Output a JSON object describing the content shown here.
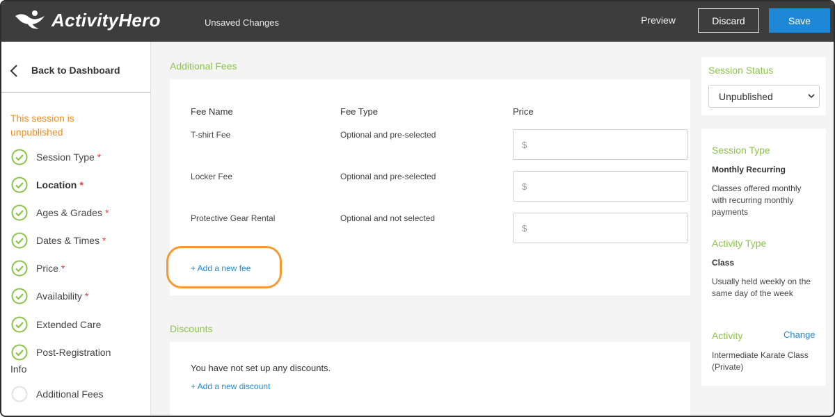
{
  "header": {
    "logo_text": "ActivityHero",
    "status_text": "Unsaved Changes",
    "preview_label": "Preview",
    "discard_label": "Discard",
    "save_label": "Save",
    "bg_color": "#3d3d3d",
    "save_color": "#1e88d6"
  },
  "sidebar": {
    "back_label": "Back to Dashboard",
    "unpublished_note": "This session is unpublished",
    "steps": [
      {
        "label": "Session Type",
        "required": true,
        "done": true,
        "active": false
      },
      {
        "label": "Location",
        "required": true,
        "done": true,
        "active": true
      },
      {
        "label": "Ages & Grades",
        "required": true,
        "done": true,
        "active": false
      },
      {
        "label": "Dates & Times",
        "required": true,
        "done": true,
        "active": false
      },
      {
        "label": "Price",
        "required": true,
        "done": true,
        "active": false
      },
      {
        "label": "Availability",
        "required": true,
        "done": true,
        "active": false
      },
      {
        "label": "Extended Care",
        "required": false,
        "done": true,
        "active": false
      },
      {
        "label": "Post-Registration",
        "label2": "Info",
        "required": false,
        "done": true,
        "active": false
      },
      {
        "label": "Additional Fees",
        "required": false,
        "done": false,
        "active": false
      }
    ],
    "required_marker": "*"
  },
  "fees": {
    "section_title": "Additional Fees",
    "columns": [
      "Fee Name",
      "Fee Type",
      "Price"
    ],
    "rows": [
      {
        "name": "T-shirt Fee",
        "type": "Optional and pre-selected",
        "price_placeholder": "$"
      },
      {
        "name": "Locker Fee",
        "type": "Optional and pre-selected",
        "price_placeholder": "$"
      },
      {
        "name": "Protective Gear Rental",
        "type": "Optional and not selected",
        "price_placeholder": "$"
      }
    ],
    "add_link": "+ Add a new fee"
  },
  "discounts": {
    "section_title": "Discounts",
    "empty_text": "You have not set up any discounts.",
    "add_link": "+ Add a new discount"
  },
  "session_status": {
    "title": "Session Status",
    "selected": "Unpublished"
  },
  "summary": {
    "session_type_title": "Session Type",
    "session_type_value": "Monthly Recurring",
    "session_type_desc": "Classes offered monthly with recurring monthly payments",
    "activity_type_title": "Activity Type",
    "activity_type_value": "Class",
    "activity_type_desc": "Usually held weekly on the same day of the week",
    "activity_title": "Activity",
    "activity_change": "Change",
    "activity_value": "Intermediate Karate Class (Private)"
  },
  "colors": {
    "accent_green": "#8bc34a",
    "warning_orange": "#f08c21",
    "link_blue": "#1e88d6",
    "required_red": "#e53935"
  }
}
